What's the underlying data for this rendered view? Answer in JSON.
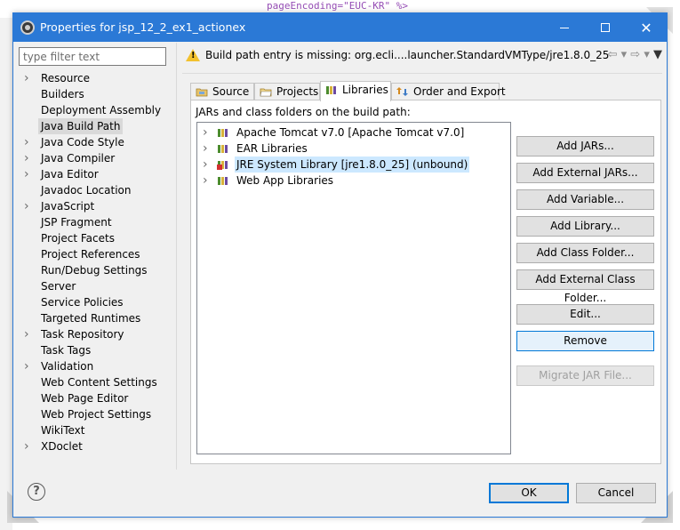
{
  "background": {
    "editor_line": "pageEncoding=\"EUC-KR\" %>"
  },
  "window": {
    "title": "Properties for jsp_12_2_ex1_actionex",
    "minimize_glyph": "—",
    "maximize_glyph": "☐",
    "close_glyph": "✕"
  },
  "filter": {
    "placeholder": "type filter text",
    "value": ""
  },
  "nav": {
    "items": [
      {
        "label": "Resource",
        "expandable": true
      },
      {
        "label": "Builders",
        "expandable": false
      },
      {
        "label": "Deployment Assembly",
        "expandable": false
      },
      {
        "label": "Java Build Path",
        "expandable": false,
        "selected": true
      },
      {
        "label": "Java Code Style",
        "expandable": true
      },
      {
        "label": "Java Compiler",
        "expandable": true
      },
      {
        "label": "Java Editor",
        "expandable": true
      },
      {
        "label": "Javadoc Location",
        "expandable": false
      },
      {
        "label": "JavaScript",
        "expandable": true
      },
      {
        "label": "JSP Fragment",
        "expandable": false
      },
      {
        "label": "Project Facets",
        "expandable": false
      },
      {
        "label": "Project References",
        "expandable": false
      },
      {
        "label": "Run/Debug Settings",
        "expandable": false
      },
      {
        "label": "Server",
        "expandable": false
      },
      {
        "label": "Service Policies",
        "expandable": false
      },
      {
        "label": "Targeted Runtimes",
        "expandable": false
      },
      {
        "label": "Task Repository",
        "expandable": true
      },
      {
        "label": "Task Tags",
        "expandable": false
      },
      {
        "label": "Validation",
        "expandable": true
      },
      {
        "label": "Web Content Settings",
        "expandable": false
      },
      {
        "label": "Web Page Editor",
        "expandable": false
      },
      {
        "label": "Web Project Settings",
        "expandable": false
      },
      {
        "label": "WikiText",
        "expandable": false
      },
      {
        "label": "XDoclet",
        "expandable": true
      }
    ]
  },
  "warning": {
    "icon": "warning-icon",
    "text": "Build path entry is missing: org.ecli....launcher.StandardVMType/jre1.8.0_25",
    "back_glyph": "⇦",
    "forward_glyph": "⇨",
    "dropdown_glyph": "▾",
    "menu_glyph": "▼"
  },
  "tabs": [
    {
      "label": "Source",
      "icon": "source-folder-icon"
    },
    {
      "label": "Projects",
      "icon": "projects-icon"
    },
    {
      "label": "Libraries",
      "icon": "libraries-icon",
      "active": true
    },
    {
      "label": "Order and Export",
      "icon": "order-export-icon"
    }
  ],
  "libraries": {
    "heading": "JARs and class folders on the build path:",
    "items": [
      {
        "label": "Apache Tomcat v7.0 [Apache Tomcat v7.0]",
        "icon": "library-icon"
      },
      {
        "label": "EAR Libraries",
        "icon": "library-icon"
      },
      {
        "label": "JRE System Library [jre1.8.0_25] (unbound)",
        "icon": "library-error-icon",
        "selected": true
      },
      {
        "label": "Web App Libraries",
        "icon": "library-icon"
      }
    ]
  },
  "buttons": {
    "add_jars": "Add JARs...",
    "add_external_jars": "Add External JARs...",
    "add_variable": "Add Variable...",
    "add_library": "Add Library...",
    "add_class_folder": "Add Class Folder...",
    "add_external_class_folder": "Add External Class Folder...",
    "edit": "Edit...",
    "remove": "Remove",
    "migrate_jar": "Migrate JAR File..."
  },
  "footer": {
    "help": "?",
    "ok": "OK",
    "cancel": "Cancel"
  },
  "colors": {
    "title_bar": "#2b79d6",
    "selection": "#cce8ff",
    "warning": "#f2c12e"
  }
}
